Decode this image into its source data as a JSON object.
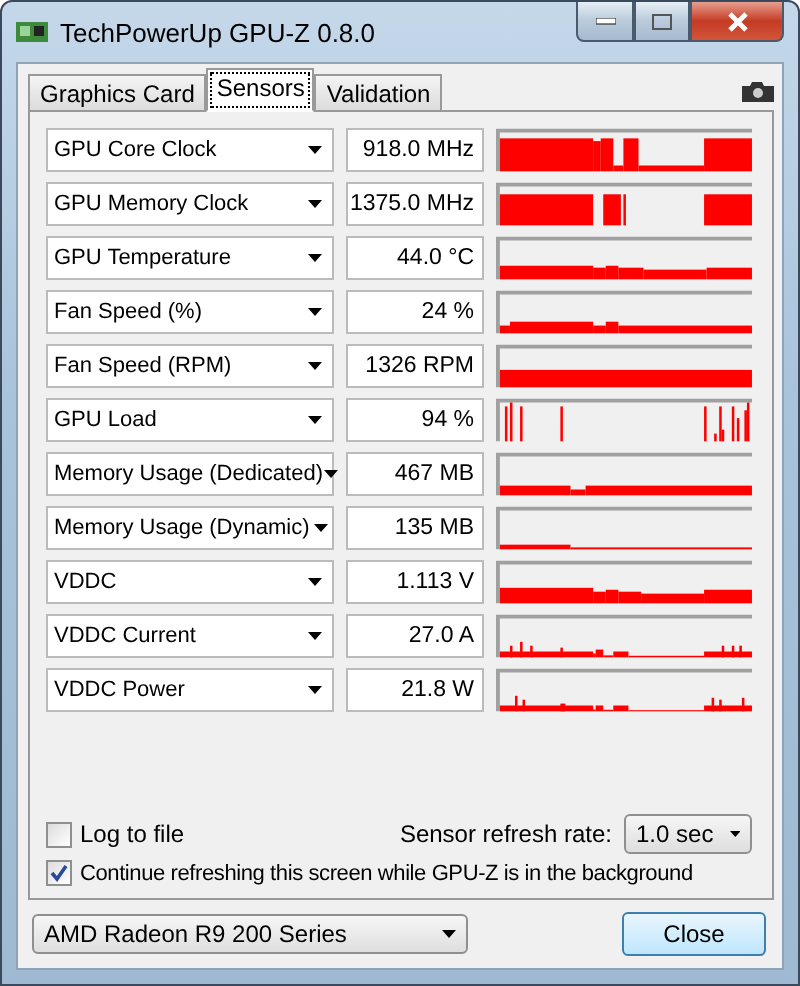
{
  "window": {
    "title": "TechPowerUp GPU-Z 0.8.0"
  },
  "tabs": [
    {
      "label": "Graphics Card",
      "selected": false
    },
    {
      "label": "Sensors",
      "selected": true
    },
    {
      "label": "Validation",
      "selected": false
    }
  ],
  "sensors": [
    {
      "label": "GPU Core Clock",
      "value": "918.0 MHz"
    },
    {
      "label": "GPU Memory Clock",
      "value": "1375.0 MHz"
    },
    {
      "label": "GPU Temperature",
      "value": "44.0 °C"
    },
    {
      "label": "Fan Speed (%)",
      "value": "24 %"
    },
    {
      "label": "Fan Speed (RPM)",
      "value": "1326 RPM"
    },
    {
      "label": "GPU Load",
      "value": "94 %"
    },
    {
      "label": "Memory Usage (Dedicated)",
      "value": "467 MB"
    },
    {
      "label": "Memory Usage (Dynamic)",
      "value": "135 MB"
    },
    {
      "label": "VDDC",
      "value": "1.113 V"
    },
    {
      "label": "VDDC Current",
      "value": "27.0 A"
    },
    {
      "label": "VDDC Power",
      "value": "21.8 W"
    }
  ],
  "log_to_file": {
    "label": "Log to file",
    "checked": false
  },
  "refresh_rate": {
    "label": "Sensor refresh rate:",
    "value": "1.0 sec"
  },
  "continue_refreshing": {
    "label": "Continue refreshing this screen while GPU-Z is in the background",
    "checked": true
  },
  "device_select": {
    "value": "AMD Radeon R9 200 Series"
  },
  "close_button": {
    "label": "Close"
  }
}
